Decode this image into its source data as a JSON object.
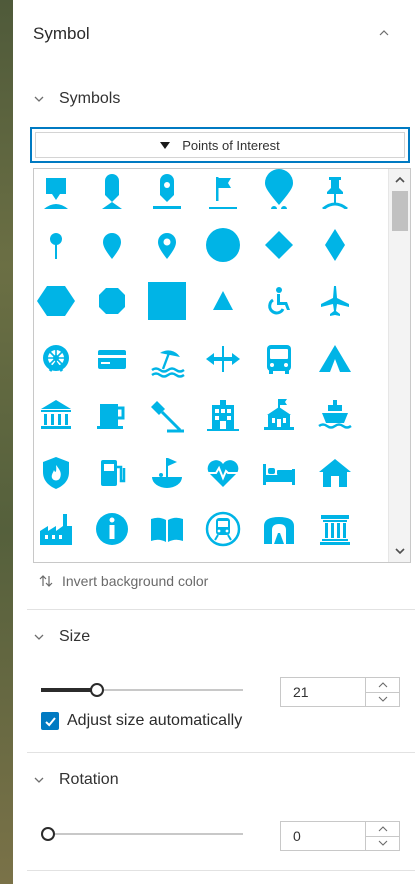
{
  "panel": {
    "title": "Symbol"
  },
  "symbols_section": {
    "label": "Symbols",
    "dropdown_value": "Points of Interest"
  },
  "icons": [
    "map-pin-square-icon",
    "map-pin-rounded-icon",
    "map-pin-hole-icon",
    "flag-icon",
    "map-pin-large-icon",
    "push-pin-icon",
    "push-pin-round-icon",
    "map-pin-drop-icon",
    "map-pin-hollow-icon",
    "circle-icon",
    "diamond-icon",
    "diamond-tall-icon",
    "hexagon-icon",
    "octagon-icon",
    "square-icon",
    "triangle-icon",
    "wheelchair-icon",
    "airplane-icon",
    "ferris-wheel-icon",
    "credit-card-icon",
    "beach-umbrella-icon",
    "horizontal-arrows-icon",
    "bus-icon",
    "tent-icon",
    "museum-icon",
    "coffee-mug-icon",
    "flag-route-icon",
    "building-icon",
    "school-icon",
    "ship-icon",
    "fire-station-icon",
    "gas-pump-icon",
    "golf-icon",
    "heart-rate-icon",
    "bed-icon",
    "home-icon",
    "factory-icon",
    "information-icon",
    "open-book-icon",
    "train-icon",
    "tunnel-icon",
    "columns-icon",
    "more-1-icon",
    "more-2-icon",
    "more-3-icon",
    "more-4-icon",
    "more-5-icon",
    "more-6-icon"
  ],
  "invert": {
    "label": "Invert background color"
  },
  "size_section": {
    "label": "Size",
    "value": "21",
    "slider_fraction": 0.26,
    "auto_label": "Adjust size automatically",
    "auto_checked": true
  },
  "rotation_section": {
    "label": "Rotation",
    "value": "0",
    "slider_fraction": 0.0
  },
  "colors": {
    "accent": "#007ac2",
    "symbol": "#00b4e6"
  }
}
